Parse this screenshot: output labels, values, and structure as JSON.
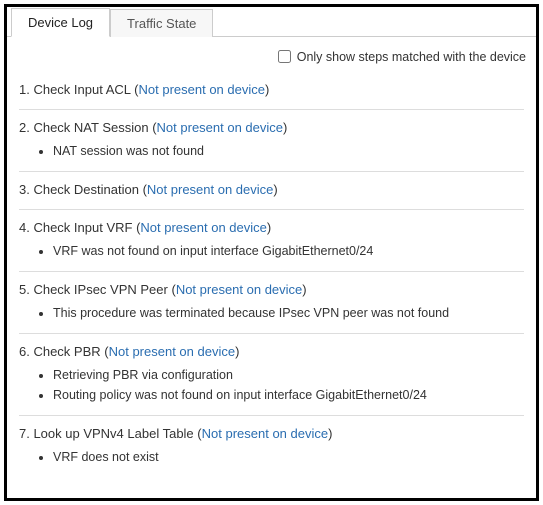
{
  "tabs": {
    "device_log": "Device Log",
    "traffic_state": "Traffic State"
  },
  "filter": {
    "label": "Only show steps matched with the device"
  },
  "note": "Not present on device",
  "steps": [
    {
      "num": "1.",
      "title": "Check Input ACL",
      "details": []
    },
    {
      "num": "2.",
      "title": "Check NAT Session",
      "details": [
        "NAT session was not found"
      ]
    },
    {
      "num": "3.",
      "title": "Check Destination",
      "details": []
    },
    {
      "num": "4.",
      "title": "Check Input VRF",
      "details": [
        "VRF was not found on input interface GigabitEthernet0/24"
      ]
    },
    {
      "num": "5.",
      "title": "Check IPsec VPN Peer",
      "details": [
        "This procedure was terminated because IPsec VPN peer was not found"
      ]
    },
    {
      "num": "6.",
      "title": "Check PBR",
      "details": [
        "Retrieving PBR via configuration",
        "Routing policy was not found on input interface GigabitEthernet0/24"
      ]
    },
    {
      "num": "7.",
      "title": "Look up VPNv4 Label Table",
      "details": [
        "VRF does not exist"
      ]
    }
  ]
}
